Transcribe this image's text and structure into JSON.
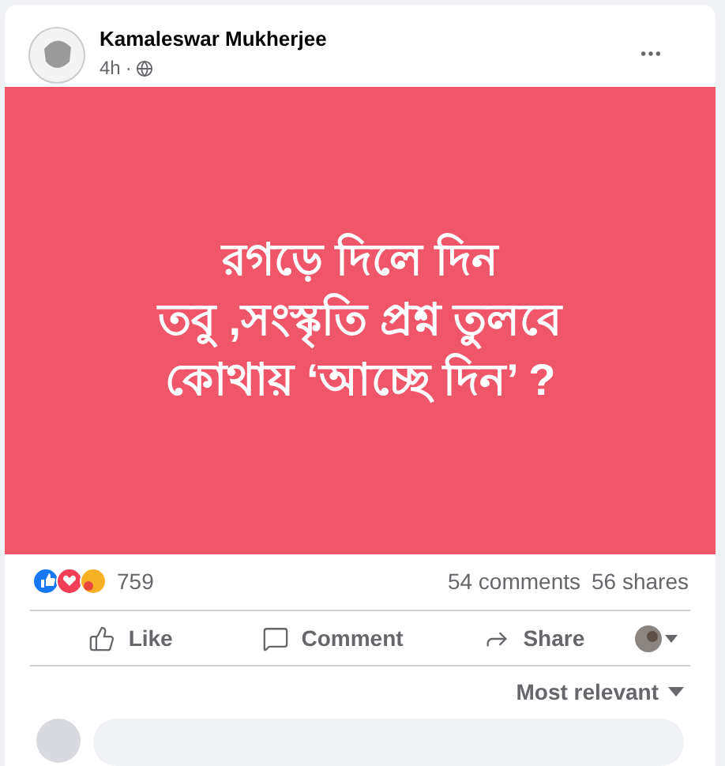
{
  "post": {
    "author": "Kamaleswar Mukherjee",
    "time": "4h",
    "separator": "·"
  },
  "image_text": [
    "রগড়ে দিলে দিন",
    "তবু ,সংস্কৃতি প্রশ্ন তুলবে",
    "কোথায় ‘আচ্ছে দিন’ ?"
  ],
  "stats": {
    "reactions": "759",
    "comments": "54 comments",
    "shares": "56 shares"
  },
  "actions": [
    {
      "kind": "like",
      "label": "Like"
    },
    {
      "kind": "comment",
      "label": "Comment"
    },
    {
      "kind": "share",
      "label": "Share"
    }
  ],
  "sort": {
    "label": "Most relevant"
  }
}
